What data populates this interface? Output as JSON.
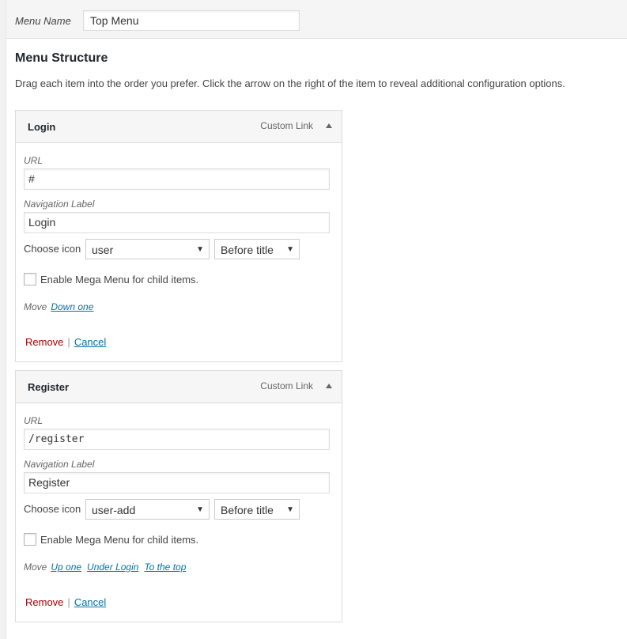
{
  "menu_name": {
    "label": "Menu Name",
    "value": "Top Menu"
  },
  "structure": {
    "title": "Menu Structure",
    "description": "Drag each item into the order you prefer. Click the arrow on the right of the item to reveal additional configuration options."
  },
  "items": [
    {
      "title": "Login",
      "type": "Custom Link",
      "url_label": "URL",
      "url": "#",
      "nav_label_label": "Navigation Label",
      "nav_label": "Login",
      "choose_icon_label": "Choose icon",
      "icon": "user",
      "icon_position": "Before title",
      "mega_menu_label": "Enable Mega Menu for child items.",
      "move_label": "Move",
      "move_links": [
        "Down one"
      ],
      "remove": "Remove",
      "separator": "|",
      "cancel": "Cancel"
    },
    {
      "title": "Register",
      "type": "Custom Link",
      "url_label": "URL",
      "url": "/register",
      "nav_label_label": "Navigation Label",
      "nav_label": "Register",
      "choose_icon_label": "Choose icon",
      "icon": "user-add",
      "icon_position": "Before title",
      "mega_menu_label": "Enable Mega Menu for child items.",
      "move_label": "Move",
      "move_links": [
        "Up one",
        "Under Login",
        "To the top"
      ],
      "remove": "Remove",
      "separator": "|",
      "cancel": "Cancel"
    }
  ],
  "colors": {
    "link": "#0073aa",
    "remove": "#aa0000",
    "header_bg": "#f5f5f5"
  }
}
